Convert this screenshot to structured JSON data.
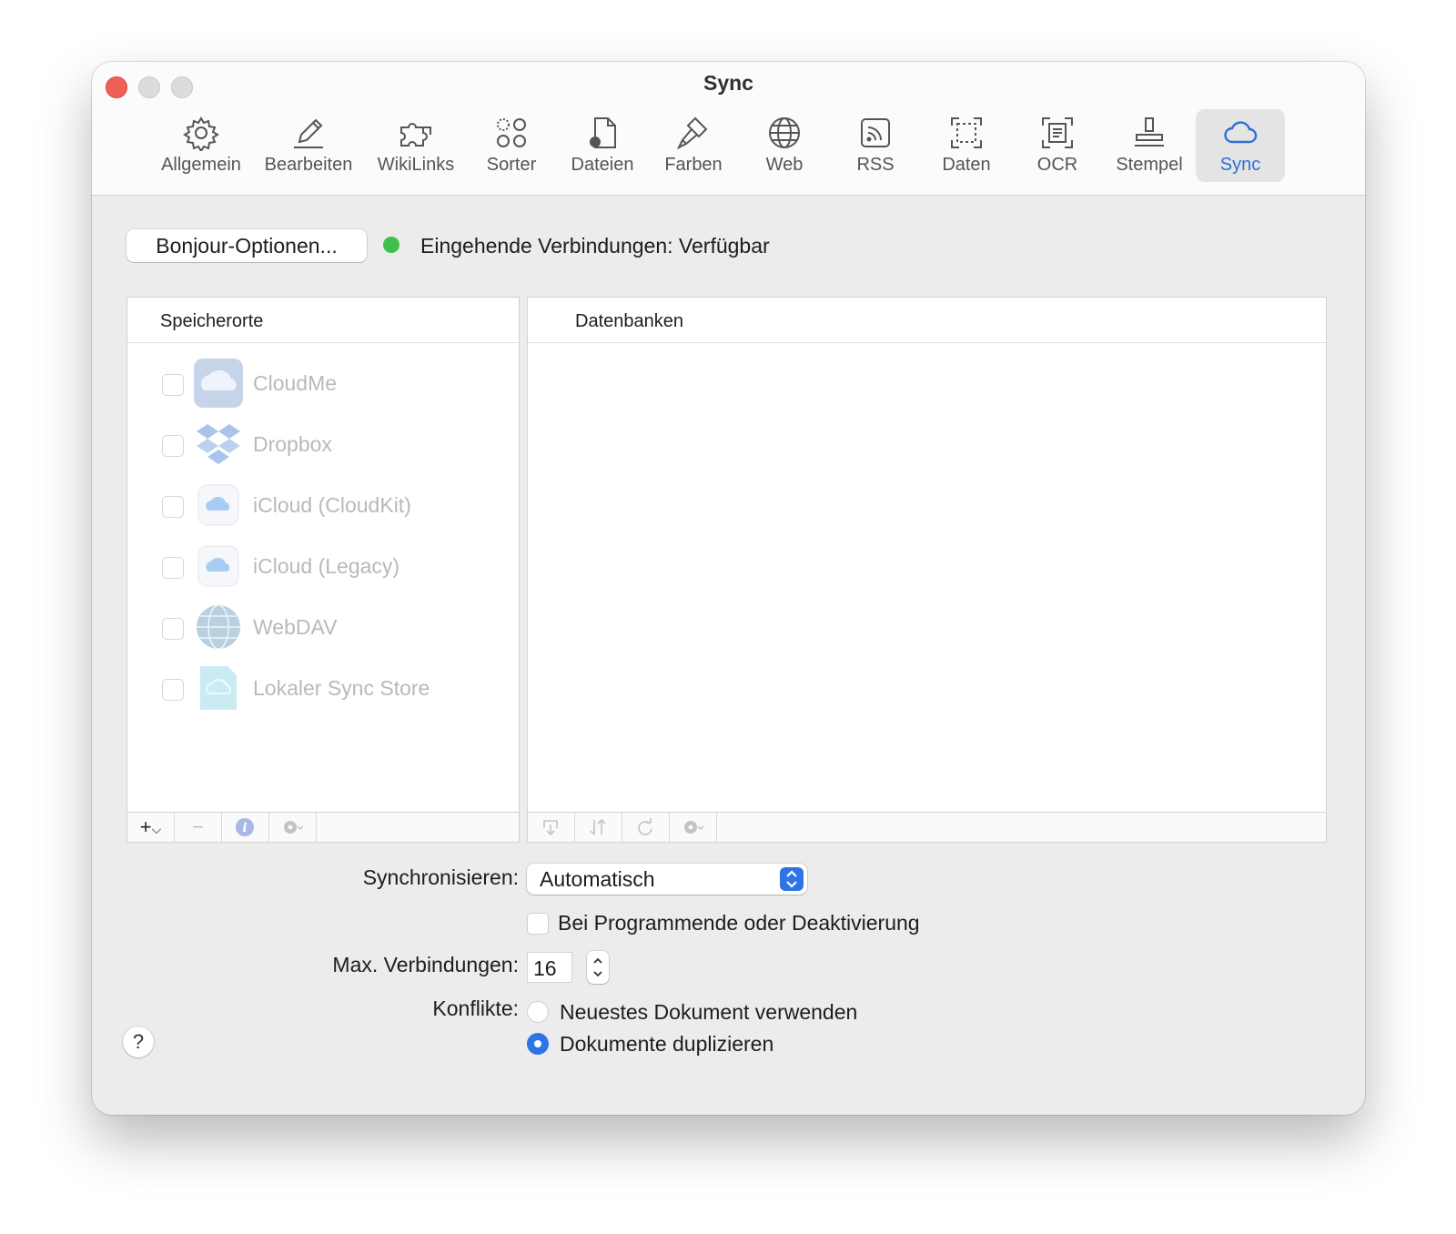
{
  "window": {
    "title": "Sync"
  },
  "toolbar": {
    "items": [
      {
        "label": "Allgemein",
        "icon": "gear-icon"
      },
      {
        "label": "Bearbeiten",
        "icon": "pencil-icon"
      },
      {
        "label": "WikiLinks",
        "icon": "puzzle-icon"
      },
      {
        "label": "Sorter",
        "icon": "circles-icon"
      },
      {
        "label": "Dateien",
        "icon": "document-gear-icon"
      },
      {
        "label": "Farben",
        "icon": "brush-icon"
      },
      {
        "label": "Web",
        "icon": "globe-icon"
      },
      {
        "label": "RSS",
        "icon": "rss-icon"
      },
      {
        "label": "Daten",
        "icon": "dashed-frame-icon"
      },
      {
        "label": "OCR",
        "icon": "ocr-scan-icon"
      },
      {
        "label": "Stempel",
        "icon": "stamp-icon"
      },
      {
        "label": "Sync",
        "icon": "cloud-icon"
      }
    ],
    "active": "Sync"
  },
  "top": {
    "bonjour_button": "Bonjour-Optionen...",
    "status_text": "Eingehende Verbindungen: Verfügbar",
    "status_color": "#3fc04b"
  },
  "locations": {
    "header": "Speicherorte",
    "items": [
      {
        "name": "CloudMe",
        "checked": false,
        "icon": "cloudme-icon"
      },
      {
        "name": "Dropbox",
        "checked": false,
        "icon": "dropbox-icon"
      },
      {
        "name": "iCloud (CloudKit)",
        "checked": false,
        "icon": "icloud-icon"
      },
      {
        "name": "iCloud (Legacy)",
        "checked": false,
        "icon": "icloud-icon"
      },
      {
        "name": "WebDAV",
        "checked": false,
        "icon": "globe-icon"
      },
      {
        "name": "Lokaler Sync Store",
        "checked": false,
        "icon": "local-sync-store-icon"
      }
    ],
    "footer": {
      "add": "+",
      "remove": "−"
    }
  },
  "databases": {
    "header": "Datenbanken"
  },
  "settings": {
    "sync_label": "Synchronisieren:",
    "sync_value": "Automatisch",
    "on_quit_label": "Bei Programmende oder Deaktivierung",
    "on_quit_checked": false,
    "max_conn_label": "Max. Verbindungen:",
    "max_conn_value": "16",
    "conflicts_label": "Konflikte:",
    "conflict_options": [
      {
        "label": "Neuestes Dokument verwenden",
        "selected": false
      },
      {
        "label": "Dokumente duplizieren",
        "selected": true
      }
    ],
    "accent_color": "#2f74e6"
  },
  "help_button": "?"
}
